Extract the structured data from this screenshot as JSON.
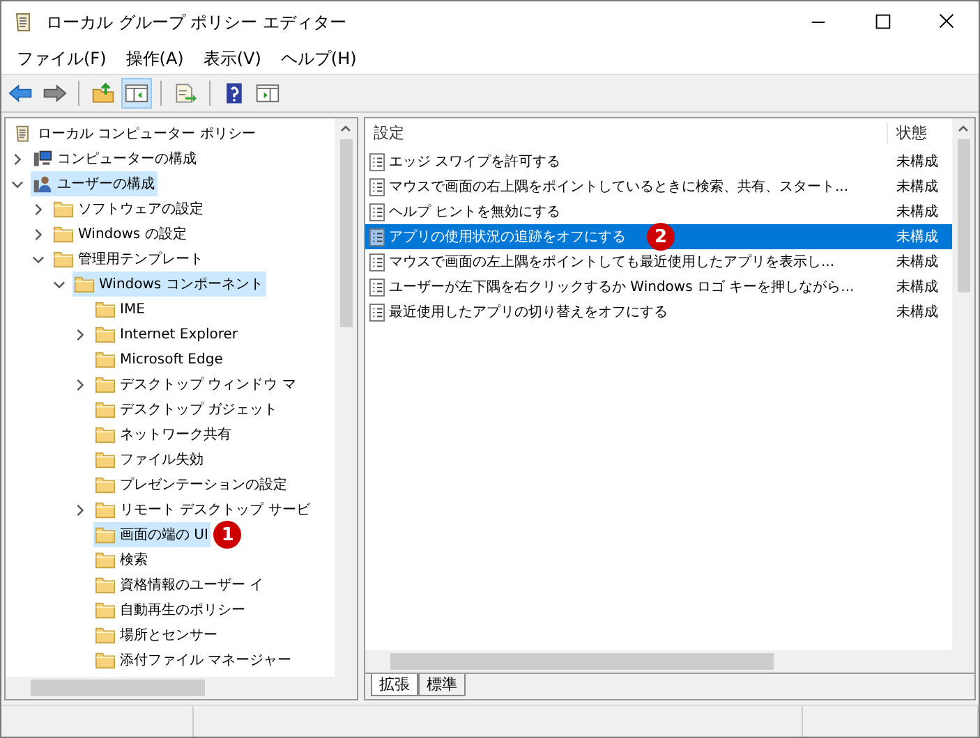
{
  "window": {
    "title": "ローカル グループ ポリシー エディター"
  },
  "menu": [
    "ファイル(F)",
    "操作(A)",
    "表示(V)",
    "ヘルプ(H)"
  ],
  "toolbar": [
    {
      "kind": "back",
      "pressed": false
    },
    {
      "kind": "forward",
      "pressed": false
    },
    {
      "kind": "separator"
    },
    {
      "kind": "up",
      "pressed": false
    },
    {
      "kind": "console-tree",
      "pressed": true
    },
    {
      "kind": "separator"
    },
    {
      "kind": "export",
      "pressed": false
    },
    {
      "kind": "separator"
    },
    {
      "kind": "help",
      "pressed": false
    },
    {
      "kind": "action-pane",
      "pressed": false
    }
  ],
  "tree": {
    "label": "ローカル コンピューター ポリシー",
    "kind": "policy",
    "selected": false,
    "children": [
      {
        "label": "コンピューターの構成",
        "kind": "computer",
        "expanded": false,
        "selected": false
      },
      {
        "label": "ユーザーの構成",
        "kind": "user",
        "expanded": true,
        "selected": true,
        "children": [
          {
            "label": "ソフトウェアの設定",
            "kind": "folder",
            "expanded": false,
            "selected": false
          },
          {
            "label": "Windows の設定",
            "kind": "folder",
            "expanded": false,
            "selected": false
          },
          {
            "label": "管理用テンプレート",
            "kind": "folder",
            "expanded": true,
            "selected": false,
            "children": [
              {
                "label": "Windows コンポーネント",
                "kind": "folder",
                "expanded": true,
                "selected": true,
                "children": [
                  {
                    "label": "IME",
                    "kind": "folder",
                    "selected": false
                  },
                  {
                    "label": "Internet Explorer",
                    "kind": "folder",
                    "expanded": false,
                    "selected": false
                  },
                  {
                    "label": "Microsoft Edge",
                    "kind": "folder",
                    "selected": false
                  },
                  {
                    "label": "デスクトップ ウィンドウ マ",
                    "kind": "folder",
                    "expanded": false,
                    "selected": false
                  },
                  {
                    "label": "デスクトップ ガジェット",
                    "kind": "folder",
                    "selected": false
                  },
                  {
                    "label": "ネットワーク共有",
                    "kind": "folder",
                    "selected": false
                  },
                  {
                    "label": "ファイル失効",
                    "kind": "folder",
                    "selected": false
                  },
                  {
                    "label": "プレゼンテーションの設定",
                    "kind": "folder",
                    "selected": false
                  },
                  {
                    "label": "リモート デスクトップ サービ",
                    "kind": "folder",
                    "expanded": false,
                    "selected": false
                  },
                  {
                    "label": "画面の端の UI",
                    "kind": "folder",
                    "selected": true,
                    "badge": "1"
                  },
                  {
                    "label": "検索",
                    "kind": "folder",
                    "selected": false
                  },
                  {
                    "label": "資格情報のユーザー イ",
                    "kind": "folder",
                    "selected": false
                  },
                  {
                    "label": "自動再生のポリシー",
                    "kind": "folder",
                    "selected": false
                  },
                  {
                    "label": "場所とセンサー",
                    "kind": "folder",
                    "selected": false
                  },
                  {
                    "label": "添付ファイル マネージャー",
                    "kind": "folder",
                    "selected": false
                  }
                ]
              }
            ]
          }
        ]
      }
    ]
  },
  "table": {
    "columns": [
      "設定",
      "状態"
    ],
    "rows": [
      {
        "name": "エッジ スワイプを許可する",
        "state": "未構成",
        "selected": false
      },
      {
        "name": "マウスで画面の右上隅をポイントしているときに検索、共有、スタート...",
        "state": "未構成",
        "selected": false
      },
      {
        "name": "ヘルプ ヒントを無効にする",
        "state": "未構成",
        "selected": false
      },
      {
        "name": "アプリの使用状況の追跡をオフにする",
        "state": "未構成",
        "selected": true,
        "badge": "2"
      },
      {
        "name": "マウスで画面の左上隅をポイントしても最近使用したアプリを表示し...",
        "state": "未構成",
        "selected": false
      },
      {
        "name": "ユーザーが左下隅を右クリックするか Windows ロゴ キーを押しながら...",
        "state": "未構成",
        "selected": false
      },
      {
        "name": "最近使用したアプリの切り替えをオフにする",
        "state": "未構成",
        "selected": false
      }
    ]
  },
  "view_tabs": [
    {
      "label": "拡張",
      "selected": true
    },
    {
      "label": "標準",
      "selected": false
    }
  ]
}
